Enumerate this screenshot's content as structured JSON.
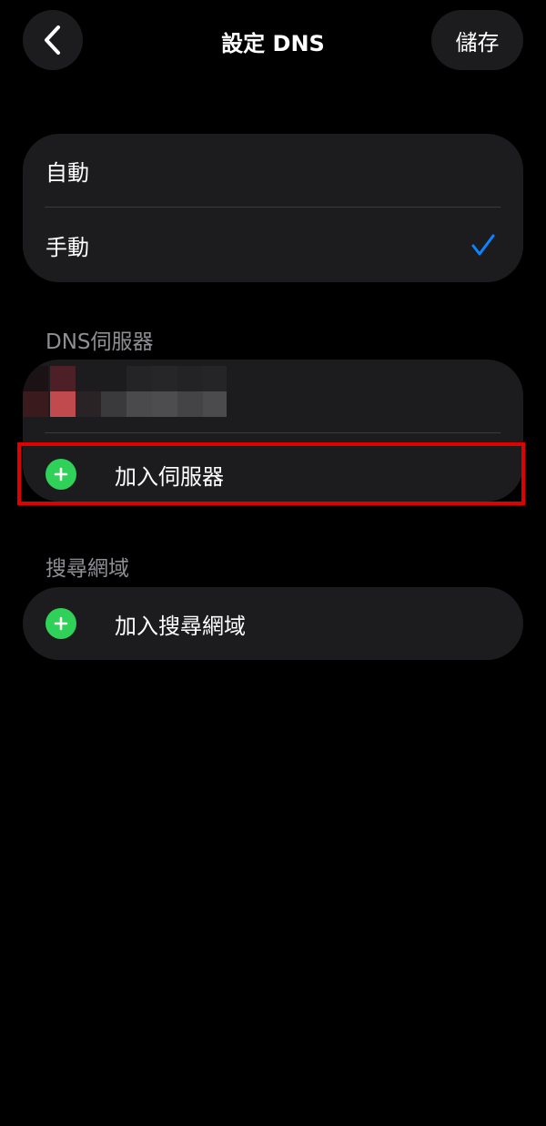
{
  "nav": {
    "title": "設定 DNS",
    "save_label": "儲存",
    "back_icon": "chevron-left-icon"
  },
  "mode": {
    "options": [
      {
        "label": "自動",
        "selected": false
      },
      {
        "label": "手動",
        "selected": true
      }
    ],
    "check_color": "#0a84ff"
  },
  "dns_section": {
    "header": "DNS伺服器",
    "add_label": "加入伺服器",
    "plus_icon": "plus-circle-icon",
    "accent": "#30d158"
  },
  "search_section": {
    "header": "搜尋網域",
    "add_label": "加入搜尋網域"
  },
  "highlight_color": "#e00000"
}
